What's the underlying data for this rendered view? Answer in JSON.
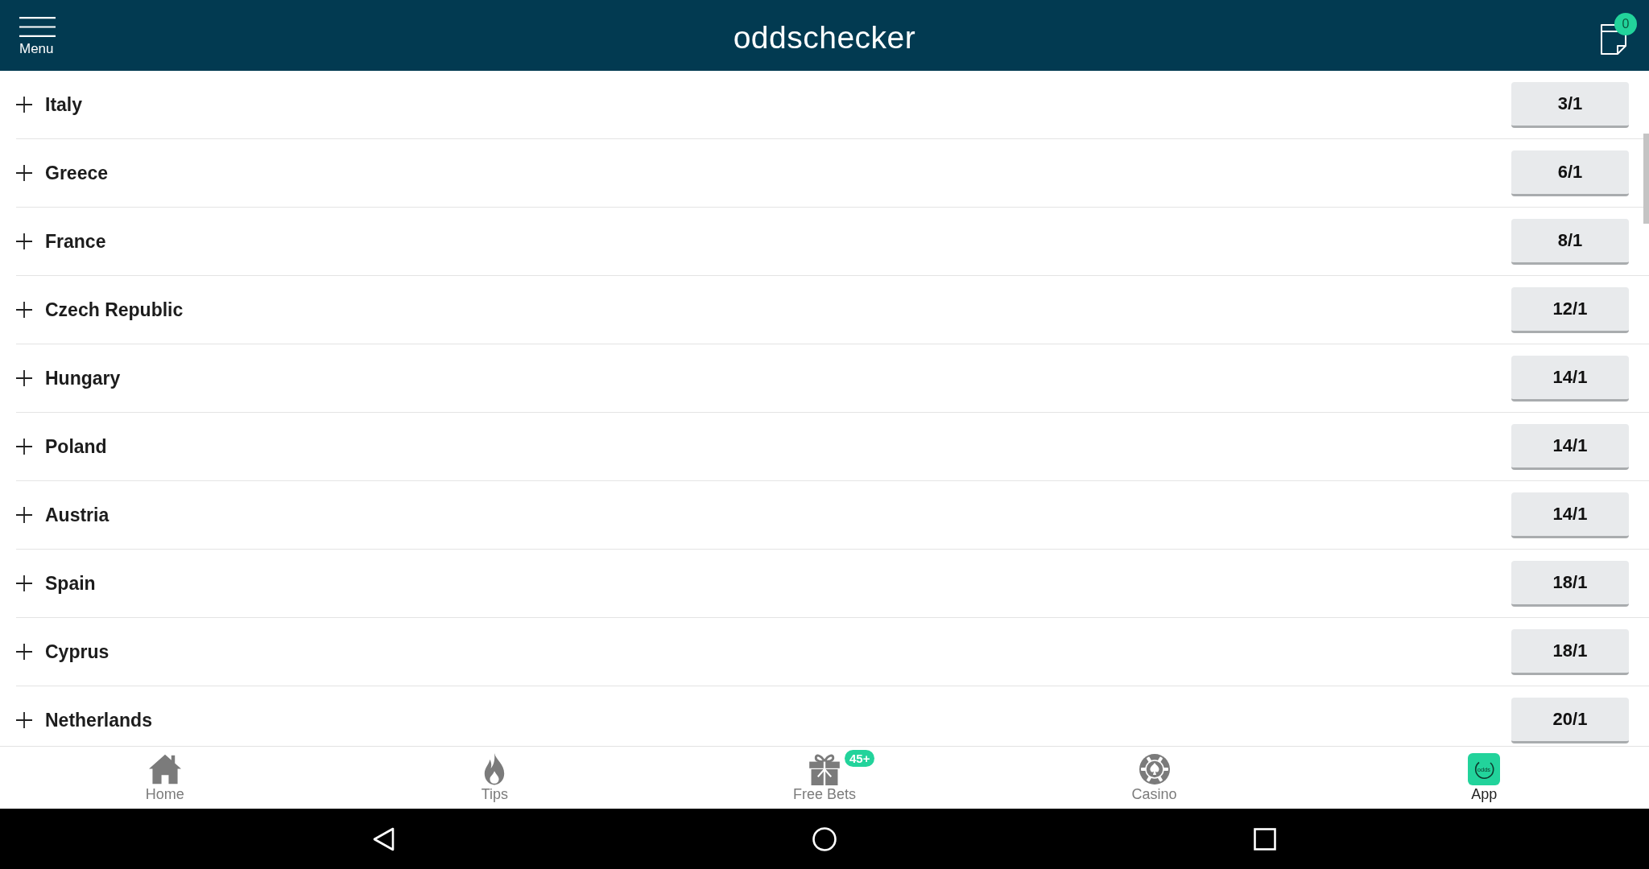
{
  "header": {
    "menu_label": "Menu",
    "logo": "oddschecker",
    "betslip_count": "0"
  },
  "rows": [
    {
      "name": "Italy",
      "odds": "3/1",
      "expanded": false
    },
    {
      "name": "Greece",
      "odds": "6/1",
      "expanded": false
    },
    {
      "name": "France",
      "odds": "8/1",
      "expanded": false
    },
    {
      "name": "Czech Republic",
      "odds": "12/1",
      "expanded": false
    },
    {
      "name": "Hungary",
      "odds": "14/1",
      "expanded": false
    },
    {
      "name": "Poland",
      "odds": "14/1",
      "expanded": false
    },
    {
      "name": "Austria",
      "odds": "14/1",
      "expanded": false
    },
    {
      "name": "Spain",
      "odds": "18/1",
      "expanded": false
    },
    {
      "name": "Cyprus",
      "odds": "18/1",
      "expanded": false
    },
    {
      "name": "Netherlands",
      "odds": "20/1",
      "expanded": false
    }
  ],
  "bottom_nav": [
    {
      "kind": "home",
      "label": "Home"
    },
    {
      "kind": "tips",
      "label": "Tips"
    },
    {
      "kind": "free-bets",
      "label": "Free Bets",
      "badge": "45+"
    },
    {
      "kind": "casino",
      "label": "Casino"
    },
    {
      "kind": "app",
      "label": "App",
      "icon_text": "odds"
    }
  ]
}
